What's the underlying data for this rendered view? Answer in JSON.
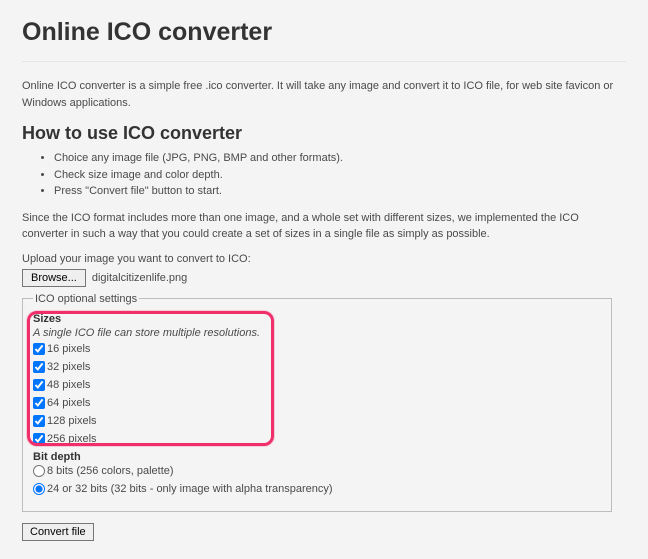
{
  "title": "Online ICO converter",
  "intro": "Online ICO converter is a simple free .ico converter. It will take any image and convert it to ICO file, for web site favicon or Windows applications.",
  "howto_heading": "How to use ICO converter",
  "steps": [
    "Choice any image file (JPG, PNG, BMP and other formats).",
    "Check size image and color depth.",
    "Press \"Convert file\" button to start."
  ],
  "since_text": "Since the ICO format includes more than one image, and a whole set with different sizes, we implemented the ICO converter in such a way that you could create a set of sizes in a single file as simply as possible.",
  "upload_label": "Upload your image you want to convert to ICO:",
  "browse_label": "Browse...",
  "file_name": "digitalcitizenlife.png",
  "fieldset_legend": "ICO optional settings",
  "sizes": {
    "title": "Sizes",
    "subtitle": "A single ICO file can store multiple resolutions.",
    "options": [
      {
        "label": "16 pixels",
        "checked": true
      },
      {
        "label": "32 pixels",
        "checked": true
      },
      {
        "label": "48 pixels",
        "checked": true
      },
      {
        "label": "64 pixels",
        "checked": true
      },
      {
        "label": "128 pixels",
        "checked": true
      },
      {
        "label": "256 pixels",
        "checked": true
      }
    ]
  },
  "bitdepth": {
    "title": "Bit depth",
    "options": [
      {
        "label": "8 bits (256 colors, palette)",
        "selected": false
      },
      {
        "label": "24 or 32 bits (32 bits - only image with alpha transparency)",
        "selected": true
      }
    ]
  },
  "convert_label": "Convert file"
}
